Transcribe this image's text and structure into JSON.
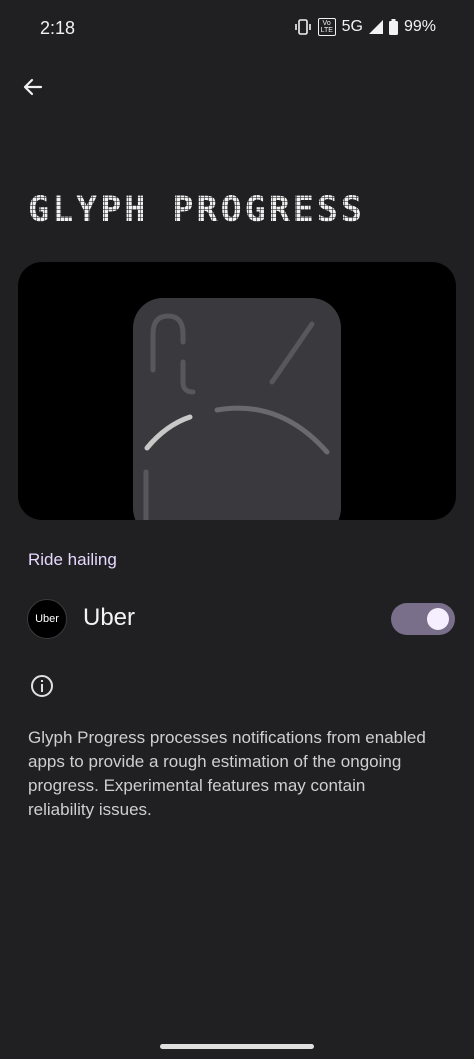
{
  "status_bar": {
    "time": "2:18",
    "volte_top": "Vo",
    "volte_bottom": "LTE",
    "network": "5G",
    "battery": "99%"
  },
  "header": {
    "title": "GLYPH PROGRESS"
  },
  "section": {
    "label": "Ride hailing"
  },
  "apps": [
    {
      "name": "Uber",
      "logo_text": "Uber",
      "enabled": true
    }
  ],
  "info": {
    "description": "Glyph Progress processes notifications from enabled apps to provide a rough estimation of the ongoing progress. Experimental features may contain reliability issues."
  },
  "colors": {
    "background": "#202022",
    "accent": "#e6d7ff",
    "toggle_track": "#7a6f8a"
  }
}
